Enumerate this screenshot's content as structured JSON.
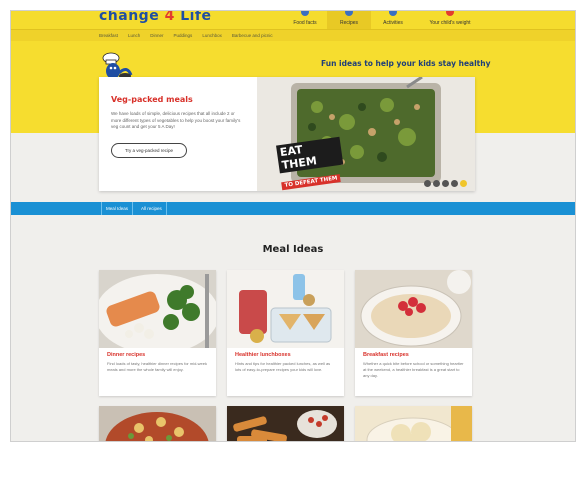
{
  "header": {
    "logo_prefix": "change ",
    "logo_four": "4",
    "logo_suffix": " Life",
    "nav": [
      {
        "label": "Food facts"
      },
      {
        "label": "Recipes"
      },
      {
        "label": "Activities"
      },
      {
        "label": "Your child's weight"
      }
    ],
    "subnav": [
      "Breakfast",
      "Lunch",
      "Dinner",
      "Puddings",
      "Lunchbox",
      "Barbecue and picnic"
    ],
    "tagline": "Fun ideas to help your kids stay healthy"
  },
  "hero": {
    "title": "Veg-packed meals",
    "description": "We have loads of simple, delicious recipes that all include 2 or more different types of vegetables to help you boost your family's veg count and get your 5 A Day!",
    "button_label": "Try a veg-packed recipe",
    "badge_line1": "EAT THEM",
    "badge_line2": "TO DEFEAT THEM"
  },
  "tabs": [
    {
      "label": "Meal Ideas"
    },
    {
      "label": "All recipes"
    }
  ],
  "section_title": "Meal Ideas",
  "cards": [
    {
      "title": "Dinner recipes",
      "description": "Find loads of tasty, healthier dinner recipes for mid-week meals and more the whole family will enjoy."
    },
    {
      "title": "Healthier lunchboxes",
      "description": "Hints and tips for healthier packed lunches, as well as lots of easy-to-prepare recipes your kids will love."
    },
    {
      "title": "Breakfast recipes",
      "description": "Whether a quick bite before school or something heartier at the weekend, a healthier breakfast is a great start to any day."
    }
  ],
  "colors": {
    "brand_yellow": "#f6dd2f",
    "brand_blue": "#1a90d4",
    "accent_red": "#d8312a"
  }
}
